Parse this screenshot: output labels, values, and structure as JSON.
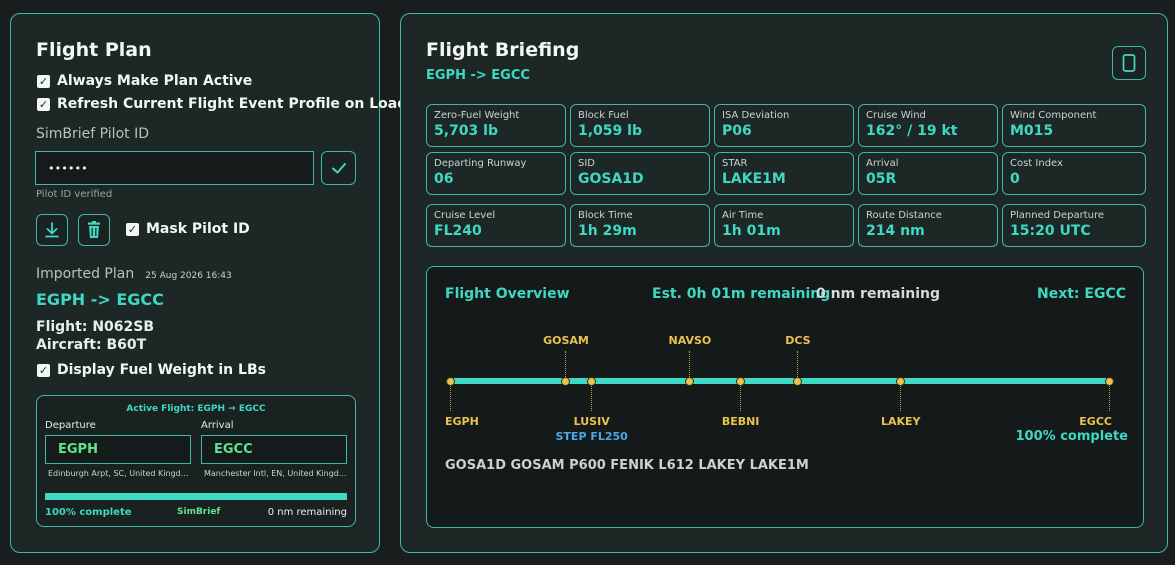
{
  "flight_plan": {
    "title": "Flight Plan",
    "always_active_label": "Always Make Plan Active",
    "refresh_profile_label": "Refresh Current Flight Event Profile on Load",
    "pilot_id_label": "SimBrief Pilot ID",
    "pilot_id_value": "••••••",
    "pilot_id_status": "Pilot ID verified",
    "mask_pilot_id_label": "Mask Pilot ID",
    "imported_label": "Imported Plan",
    "imported_time": "25 Aug 2026 16:43",
    "route": "EGPH -> EGCC",
    "flight_line": "Flight: N062SB",
    "aircraft_line": "Aircraft: B60T",
    "display_lbs_label": "Display Fuel Weight in LBs",
    "active": {
      "header": "Active Flight: EGPH → EGCC",
      "departure_label": "Departure",
      "departure_code": "EGPH",
      "departure_name": "Edinburgh Arpt, SC, United Kingd...",
      "arrival_label": "Arrival",
      "arrival_code": "EGCC",
      "arrival_name": "Manchester Intl, EN, United Kingd...",
      "progress": 1.0,
      "complete_text": "100% complete",
      "source": "SimBrief",
      "remaining": "0 nm remaining"
    }
  },
  "briefing": {
    "title": "Flight Briefing",
    "route": "EGPH -> EGCC",
    "cards": [
      {
        "label": "Zero-Fuel Weight",
        "value": "5,703 lb"
      },
      {
        "label": "Block Fuel",
        "value": "1,059 lb"
      },
      {
        "label": "ISA Deviation",
        "value": "P06"
      },
      {
        "label": "Cruise Wind",
        "value": "162° / 19 kt"
      },
      {
        "label": "Wind Component",
        "value": "M015"
      },
      {
        "label": "Departing Runway",
        "value": "06"
      },
      {
        "label": "SID",
        "value": "GOSA1D"
      },
      {
        "label": "STAR",
        "value": "LAKE1M"
      },
      {
        "label": "Arrival",
        "value": "05R"
      },
      {
        "label": "Cost Index",
        "value": "0"
      },
      {
        "label": "Cruise Level",
        "value": "FL240"
      },
      {
        "label": "Block Time",
        "value": "1h 29m"
      },
      {
        "label": "Air Time",
        "value": "1h 01m"
      },
      {
        "label": "Route Distance",
        "value": "214 nm"
      },
      {
        "label": "Planned Departure",
        "value": "15:20 UTC"
      }
    ],
    "overview": {
      "title": "Flight Overview",
      "est_remaining": "Est. 0h 01m remaining",
      "nm_remaining": "0 nm remaining",
      "next": "Next: EGCC",
      "progress": 1.0,
      "waypoints": [
        {
          "name": "EGPH",
          "pos": 0.0,
          "side": "below",
          "kind": "airport"
        },
        {
          "name": "GOSAM",
          "pos": 0.176,
          "side": "above",
          "kind": "fix"
        },
        {
          "name": "LUSIV",
          "pos": 0.215,
          "side": "below",
          "kind": "fix"
        },
        {
          "name": "NAVSO",
          "pos": 0.364,
          "side": "above",
          "kind": "fix"
        },
        {
          "name": "BEBNI",
          "pos": 0.441,
          "side": "below",
          "kind": "fix"
        },
        {
          "name": "DCS",
          "pos": 0.528,
          "side": "above",
          "kind": "fix"
        },
        {
          "name": "LAKEY",
          "pos": 0.684,
          "side": "below",
          "kind": "fix"
        },
        {
          "name": "EGCC",
          "pos": 1.0,
          "side": "below",
          "kind": "airport"
        }
      ],
      "step_climb": "STEP FL250",
      "complete": "100% complete",
      "route_string": "GOSA1D GOSAM P600 FENIK L612 LAKEY LAKE1M"
    }
  },
  "colors": {
    "accent": "#3fd8c3",
    "waypoint": "#ecc24f",
    "step": "#4aa8e8"
  },
  "icons": [
    "check-icon",
    "download-icon",
    "trash-icon",
    "tablet-icon"
  ]
}
